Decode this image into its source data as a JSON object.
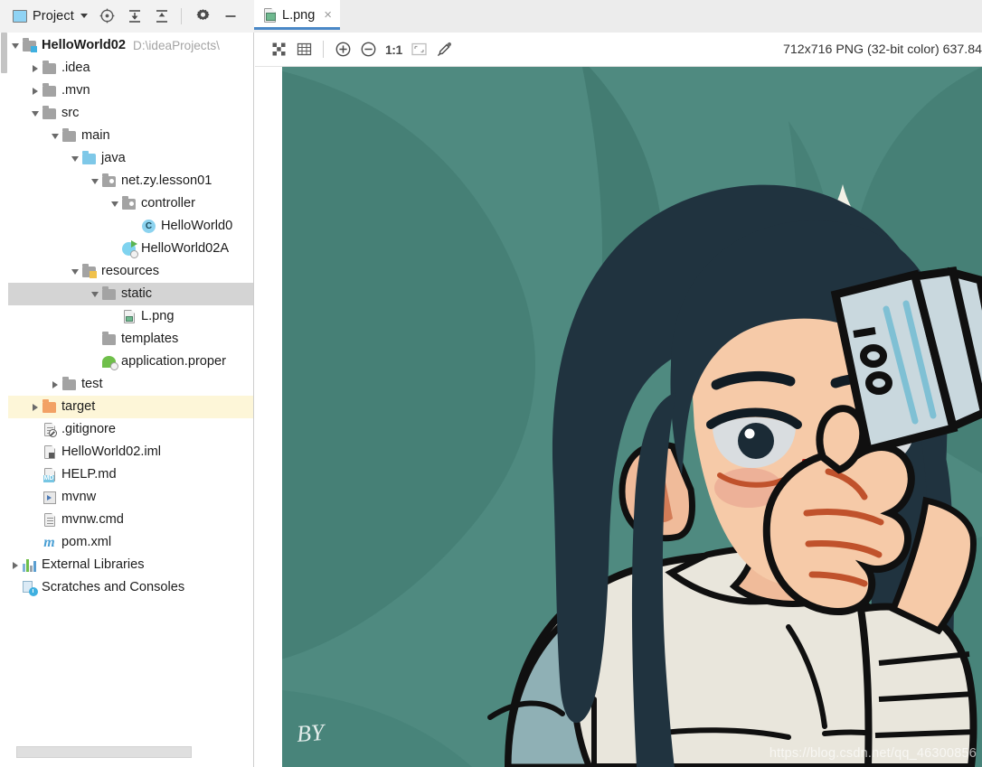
{
  "toolbar": {
    "project_label": "Project",
    "icons": [
      "locate-icon",
      "expand-all-icon",
      "collapse-all-icon",
      "settings-gear-icon",
      "minimize-icon"
    ]
  },
  "tabs": [
    {
      "label": "L.png",
      "icon": "image-file-icon",
      "close": "×",
      "active": true
    }
  ],
  "image_toolbar": {
    "icons": [
      "transparency-grid-icon",
      "pixel-grid-icon",
      "zoom-in-icon",
      "zoom-out-icon",
      "actual-size-icon",
      "fit-to-window-icon",
      "color-picker-icon"
    ],
    "zoom_label": "1:1",
    "status": "712x716 PNG (32-bit color) 637.84"
  },
  "project_tree": [
    {
      "depth": 0,
      "arrow": "down",
      "icon": "module-folder-icon",
      "label": "HelloWorld02",
      "bold": true,
      "path": "D:\\ideaProjects\\",
      "state": "normal"
    },
    {
      "depth": 1,
      "arrow": "right",
      "icon": "folder-icon",
      "label": ".idea",
      "state": "normal"
    },
    {
      "depth": 1,
      "arrow": "right",
      "icon": "folder-icon",
      "label": ".mvn",
      "state": "normal"
    },
    {
      "depth": 1,
      "arrow": "down",
      "icon": "folder-icon",
      "label": "src",
      "state": "normal"
    },
    {
      "depth": 2,
      "arrow": "down",
      "icon": "folder-icon",
      "label": "main",
      "state": "normal"
    },
    {
      "depth": 3,
      "arrow": "down",
      "icon": "source-folder-icon",
      "label": "java",
      "state": "normal"
    },
    {
      "depth": 4,
      "arrow": "down",
      "icon": "package-icon",
      "label": "net.zy.lesson01",
      "state": "normal"
    },
    {
      "depth": 5,
      "arrow": "down",
      "icon": "package-icon",
      "label": "controller",
      "state": "normal"
    },
    {
      "depth": 6,
      "arrow": "none",
      "icon": "java-class-icon",
      "label": "HelloWorld0",
      "state": "normal"
    },
    {
      "depth": 5,
      "arrow": "none",
      "icon": "spring-boot-app-icon",
      "label": "HelloWorld02A",
      "state": "normal"
    },
    {
      "depth": 3,
      "arrow": "down",
      "icon": "resources-folder-icon",
      "label": "resources",
      "state": "normal"
    },
    {
      "depth": 4,
      "arrow": "down",
      "icon": "folder-icon",
      "label": "static",
      "state": "selected"
    },
    {
      "depth": 5,
      "arrow": "none",
      "icon": "image-file-icon",
      "label": "L.png",
      "state": "normal"
    },
    {
      "depth": 4,
      "arrow": "none",
      "icon": "folder-icon",
      "label": "templates",
      "state": "normal"
    },
    {
      "depth": 4,
      "arrow": "none",
      "icon": "properties-file-icon",
      "label": "application.proper",
      "state": "normal"
    },
    {
      "depth": 2,
      "arrow": "right",
      "icon": "folder-icon",
      "label": "test",
      "state": "normal"
    },
    {
      "depth": 1,
      "arrow": "right",
      "icon": "target-folder-icon",
      "label": "target",
      "state": "highlighted"
    },
    {
      "depth": 1,
      "arrow": "none",
      "icon": "gitignore-file-icon",
      "label": ".gitignore",
      "state": "normal"
    },
    {
      "depth": 1,
      "arrow": "none",
      "icon": "iml-file-icon",
      "label": "HelloWorld02.iml",
      "state": "normal"
    },
    {
      "depth": 1,
      "arrow": "none",
      "icon": "markdown-file-icon",
      "label": "HELP.md",
      "state": "normal"
    },
    {
      "depth": 1,
      "arrow": "none",
      "icon": "shell-script-icon",
      "label": "mvnw",
      "state": "normal"
    },
    {
      "depth": 1,
      "arrow": "none",
      "icon": "text-file-icon",
      "label": "mvnw.cmd",
      "state": "normal"
    },
    {
      "depth": 1,
      "arrow": "none",
      "icon": "maven-pom-icon",
      "label": "pom.xml",
      "state": "normal"
    },
    {
      "depth": 0,
      "arrow": "right",
      "icon": "external-libraries-icon",
      "label": "External Libraries",
      "state": "normal"
    },
    {
      "depth": 0,
      "arrow": "none",
      "icon": "scratches-icon",
      "label": "Scratches and Consoles",
      "state": "normal"
    }
  ],
  "artwork": {
    "description": "Illustration of a long dark-haired girl in a cream hoodie holding a fan of 100 banknotes, teal leafy background with white sparkles",
    "banknote_value": "100",
    "signature": "BY",
    "watermark": "https://blog.csdn.net/qq_46300856",
    "colors": {
      "background": "#4f8a80",
      "background_leaf": "#437a70",
      "hair": "#20333f",
      "skin": "#f6caa8",
      "blush": "#eaa893",
      "sweater": "#e9e6dc",
      "sweater_shade": "#8fb0b5",
      "banknote": "#c9d8de",
      "banknote_stripe": "#7fc0d4",
      "outline": "#101010",
      "hand_line": "#c0522c",
      "sparkle": "#f4f2e8",
      "lip": "#c0201c"
    }
  }
}
